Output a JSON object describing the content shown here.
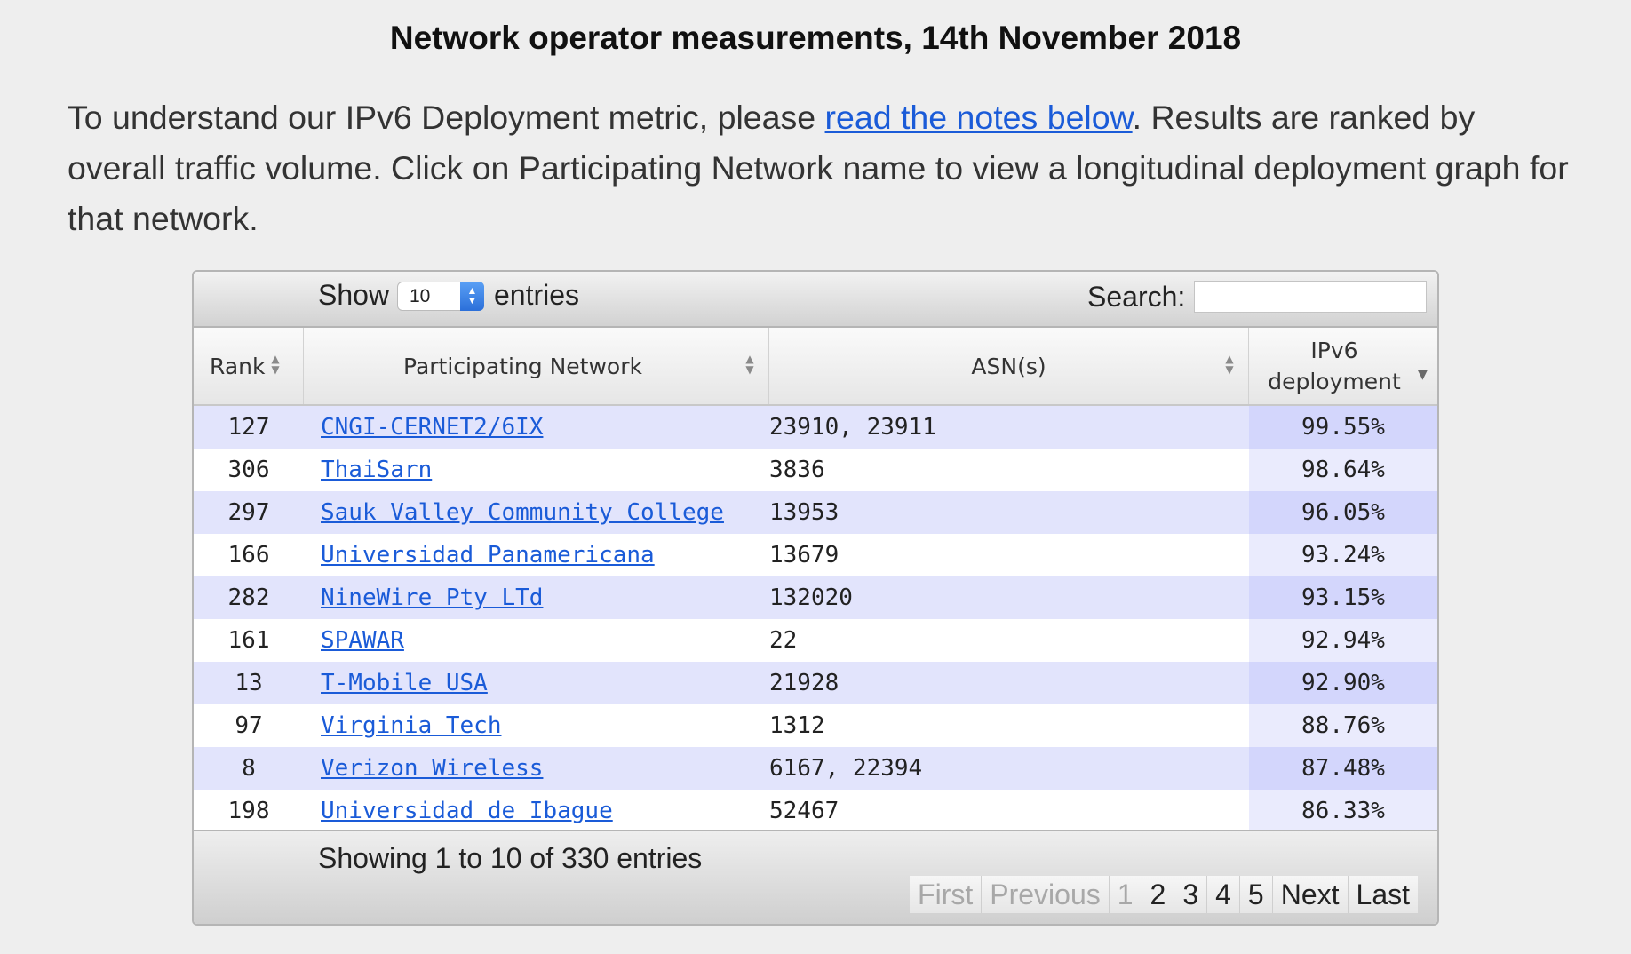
{
  "page": {
    "title": "Network operator measurements, 14th November 2018",
    "intro_before_link": "To understand our IPv6 Deployment metric, please ",
    "intro_link": "read the notes below",
    "intro_after_link": ". Results are ranked by overall traffic volume. Click on Participating Network name to view a longitudinal deployment graph for that network."
  },
  "controls": {
    "show_label": "Show",
    "length_value": "10",
    "entries_label": "entries",
    "search_label": "Search:",
    "search_value": ""
  },
  "table": {
    "columns": {
      "rank": "Rank",
      "network": "Participating Network",
      "asn": "ASN(s)",
      "ipv6_line1": "IPv6",
      "ipv6_line2": "deployment"
    },
    "sort": {
      "column": "IPv6 deployment",
      "direction": "descending"
    },
    "rows": [
      {
        "rank": "127",
        "network": "CNGI-CERNET2/6IX",
        "asn": "23910, 23911",
        "ipv6": "99.55%"
      },
      {
        "rank": "306",
        "network": "ThaiSarn",
        "asn": "3836",
        "ipv6": "98.64%"
      },
      {
        "rank": "297",
        "network": "Sauk Valley Community College",
        "asn": "13953",
        "ipv6": "96.05%"
      },
      {
        "rank": "166",
        "network": "Universidad Panamericana",
        "asn": "13679",
        "ipv6": "93.24%"
      },
      {
        "rank": "282",
        "network": "NineWire Pty LTd",
        "asn": "132020",
        "ipv6": "93.15%"
      },
      {
        "rank": "161",
        "network": "SPAWAR",
        "asn": "22",
        "ipv6": "92.94%"
      },
      {
        "rank": "13",
        "network": "T-Mobile USA",
        "asn": "21928",
        "ipv6": "92.90%"
      },
      {
        "rank": "97",
        "network": "Virginia Tech",
        "asn": "1312",
        "ipv6": "88.76%"
      },
      {
        "rank": "8",
        "network": "Verizon Wireless",
        "asn": "6167, 22394",
        "ipv6": "87.48%"
      },
      {
        "rank": "198",
        "network": "Universidad de Ibague",
        "asn": "52467",
        "ipv6": "86.33%"
      }
    ]
  },
  "footer": {
    "info": "Showing 1 to 10 of 330 entries",
    "pager": {
      "first": "First",
      "previous": "Previous",
      "pages": [
        "1",
        "2",
        "3",
        "4",
        "5"
      ],
      "next": "Next",
      "last": "Last"
    }
  },
  "colors": {
    "background": "#eeeeee",
    "link": "#1a5bd8",
    "row_odd": "#e2e4fc",
    "row_even": "#ffffff",
    "sorted_odd": "#d3d6fc",
    "sorted_even": "#eaebfd"
  }
}
